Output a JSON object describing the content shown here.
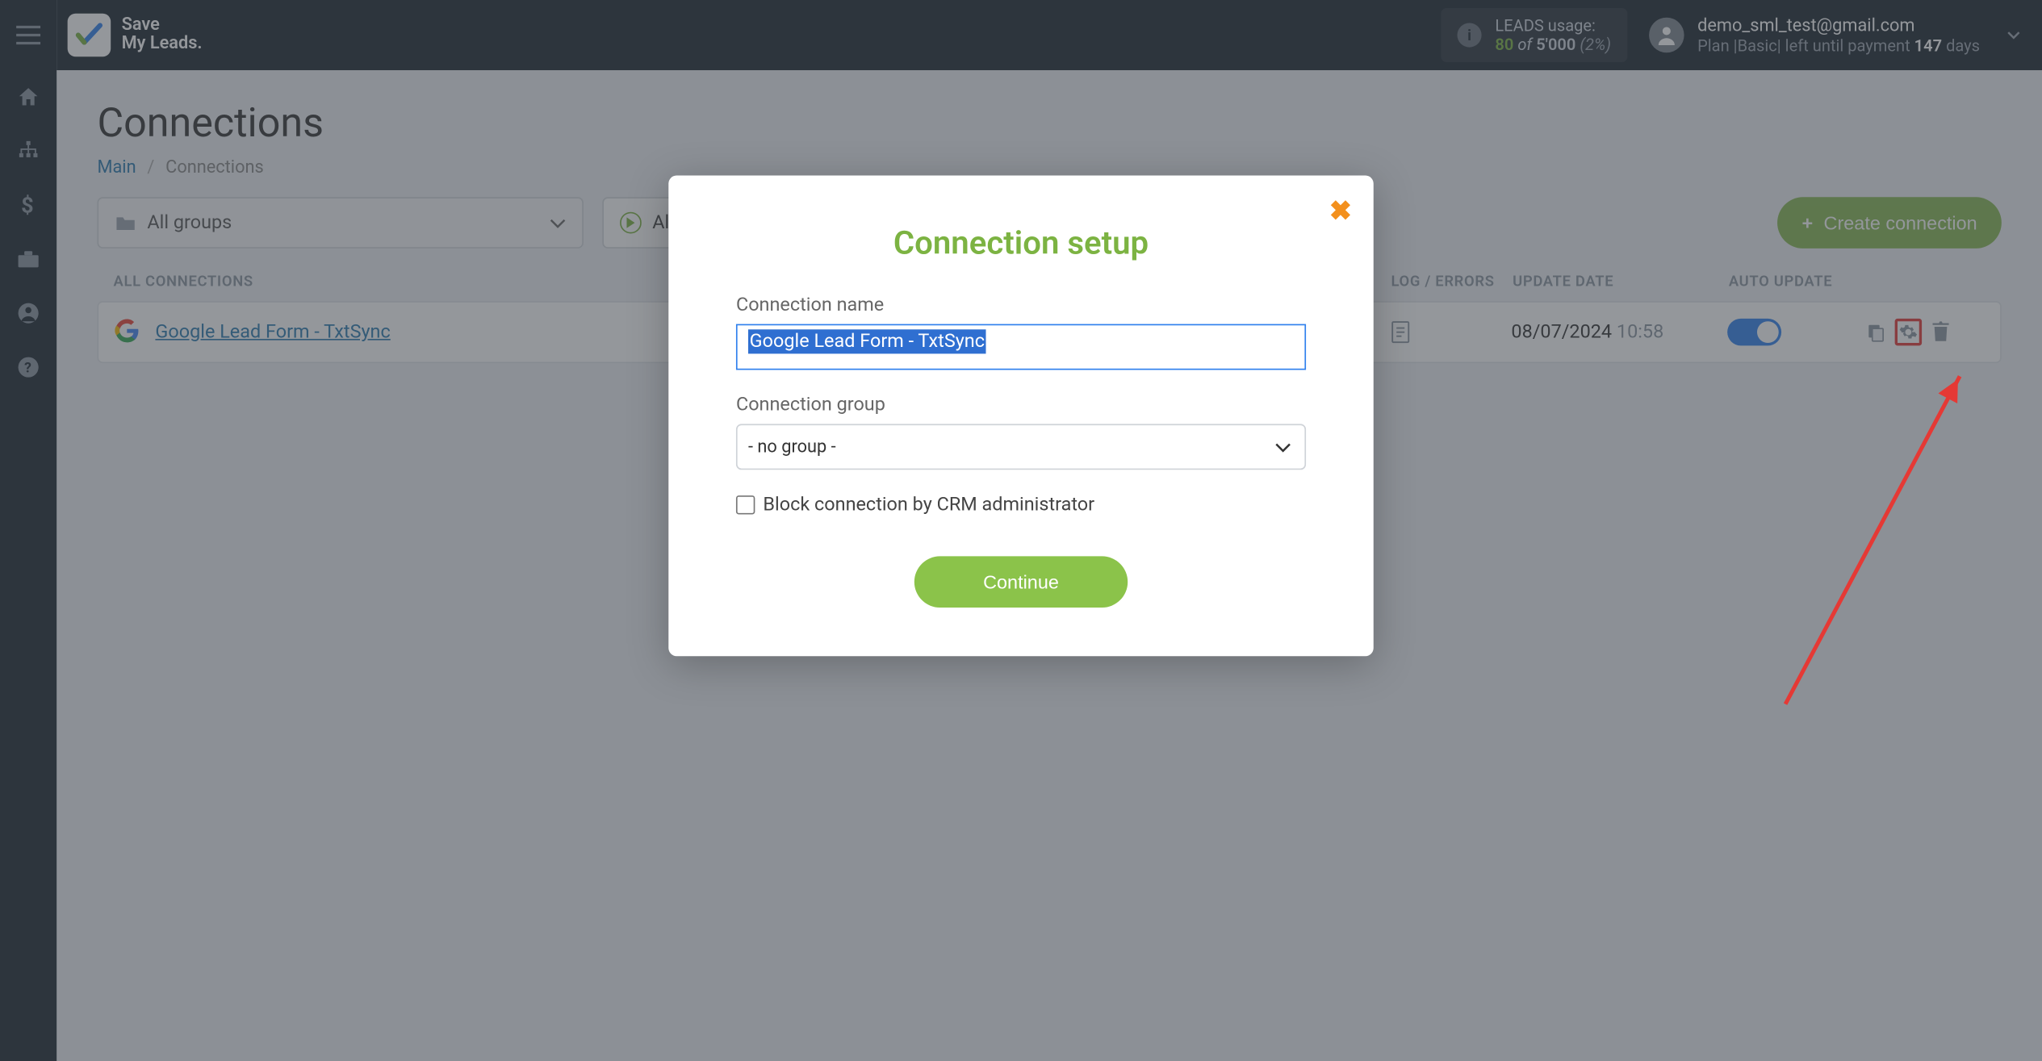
{
  "brand": {
    "line1": "Save",
    "line2": "My Leads."
  },
  "header": {
    "usage_label": "LEADS usage:",
    "usage_current": "80",
    "usage_of": "of",
    "usage_total": "5'000",
    "usage_pct": "(2%)",
    "user_email": "demo_sml_test@gmail.com",
    "plan_prefix": "Plan |",
    "plan_name": "Basic",
    "plan_mid": "| left until payment ",
    "plan_days": "147",
    "plan_days_suffix": " days"
  },
  "page": {
    "title": "Connections",
    "crumb_main": "Main",
    "crumb_current": "Connections",
    "group_selector": "All groups",
    "all_on_label": "All on",
    "create_label": "Create connection"
  },
  "table": {
    "head_all": "ALL CONNECTIONS",
    "head_log": "LOG / ERRORS",
    "head_date": "UPDATE DATE",
    "head_auto": "AUTO UPDATE",
    "row": {
      "title": "Google Lead Form - TxtSync",
      "date": "08/07/2024",
      "time": "10:58"
    }
  },
  "modal": {
    "title": "Connection setup",
    "label_name": "Connection name",
    "value_name": "Google Lead Form - TxtSync",
    "label_group": "Connection group",
    "value_group": "- no group -",
    "block_label": "Block connection by CRM administrator",
    "continue": "Continue"
  }
}
